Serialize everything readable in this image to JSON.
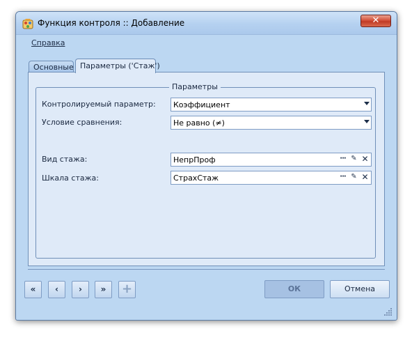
{
  "window": {
    "title": "Функция контроля :: Добавление",
    "close_symbol": "✕"
  },
  "menu": {
    "help": "Справка"
  },
  "tabs": [
    {
      "label": "Основные",
      "active": false
    },
    {
      "label": "Параметры ('Стаж')",
      "active": true
    }
  ],
  "group": {
    "title": "Параметры"
  },
  "fields": {
    "controlled_parameter": {
      "label": "Контролируемый параметр:",
      "value": "Коэффициент"
    },
    "comparison_condition": {
      "label": "Условие сравнения:",
      "value": "Не равно (≠)"
    },
    "experience_type": {
      "label": "Вид стажа:",
      "value": "НепрПроф"
    },
    "experience_scale": {
      "label": "Шкала стажа:",
      "value": "СтрахСтаж"
    }
  },
  "picker_buttons": {
    "dots": "···",
    "edit": "✎",
    "clear": "✕"
  },
  "nav": {
    "first": "«",
    "prev": "‹",
    "next": "›",
    "last": "»",
    "add": "+"
  },
  "buttons": {
    "ok": "ОК",
    "cancel": "Отмена"
  },
  "icons": {
    "app": "app-icon",
    "close": "close-icon",
    "dropdown": "chevron-down-icon",
    "browse": "ellipsis-icon",
    "edit": "pencil-icon",
    "clear": "close-icon",
    "add": "plus-icon",
    "grip": "resize-grip-icon"
  },
  "colors": {
    "window_bg": "#bcd7f2",
    "panel_bg": "#dfeaf8",
    "border": "#6f8fb8",
    "close_button": "#d4533c"
  }
}
